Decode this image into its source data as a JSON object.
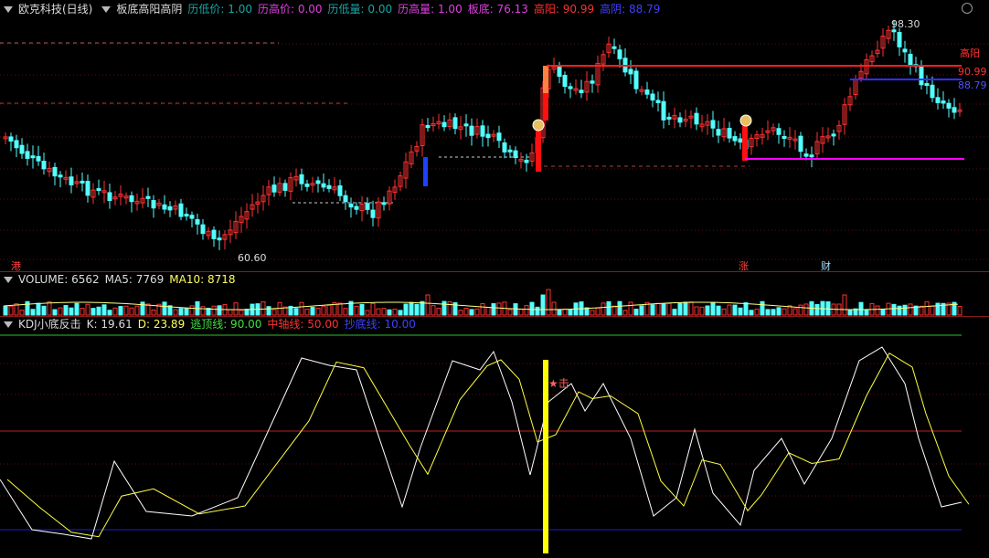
{
  "header": {
    "stock": "欧克科技(日线)",
    "indicator": "板底高阳高阴",
    "fields": [
      {
        "label": "历低价:",
        "value": "1.00",
        "color": "#19a5a5"
      },
      {
        "label": "历高价:",
        "value": "0.00",
        "color": "#e040e0"
      },
      {
        "label": "历低量:",
        "value": "0.00",
        "color": "#19a5a5"
      },
      {
        "label": "历高量:",
        "value": "1.00",
        "color": "#e040e0"
      },
      {
        "label": "板底:",
        "value": "76.13",
        "color": "#e040e0"
      },
      {
        "label": "高阳:",
        "value": "90.99",
        "color": "#ff3030"
      },
      {
        "label": "高阴:",
        "value": "88.79",
        "color": "#4040ff"
      }
    ]
  },
  "price_panel": {
    "high_label": "98.30",
    "low_label": "60.60",
    "right_labels": {
      "top": "高阳",
      "gaoyang": "90.99",
      "gaoyin": "88.79"
    },
    "markers": [
      "港",
      "涨",
      "财"
    ]
  },
  "volume_panel": {
    "title": "VOLUME: 6562",
    "ma5": "MA5: 7769",
    "ma10": "MA10: 8718"
  },
  "kdj_panel": {
    "title": "KDJ小底反击",
    "k": "K: 19.61",
    "d": "D: 23.89",
    "escape": "逃顶线: 90.00",
    "mid": "中轴线: 50.00",
    "bottom": "抄底线: 10.00",
    "signal": "★击"
  },
  "colors": {
    "up": "#ff3232",
    "down": "#54ffff",
    "yellow": "#ffff00",
    "magenta": "#ff00ff",
    "blue": "#3c3cff"
  }
}
